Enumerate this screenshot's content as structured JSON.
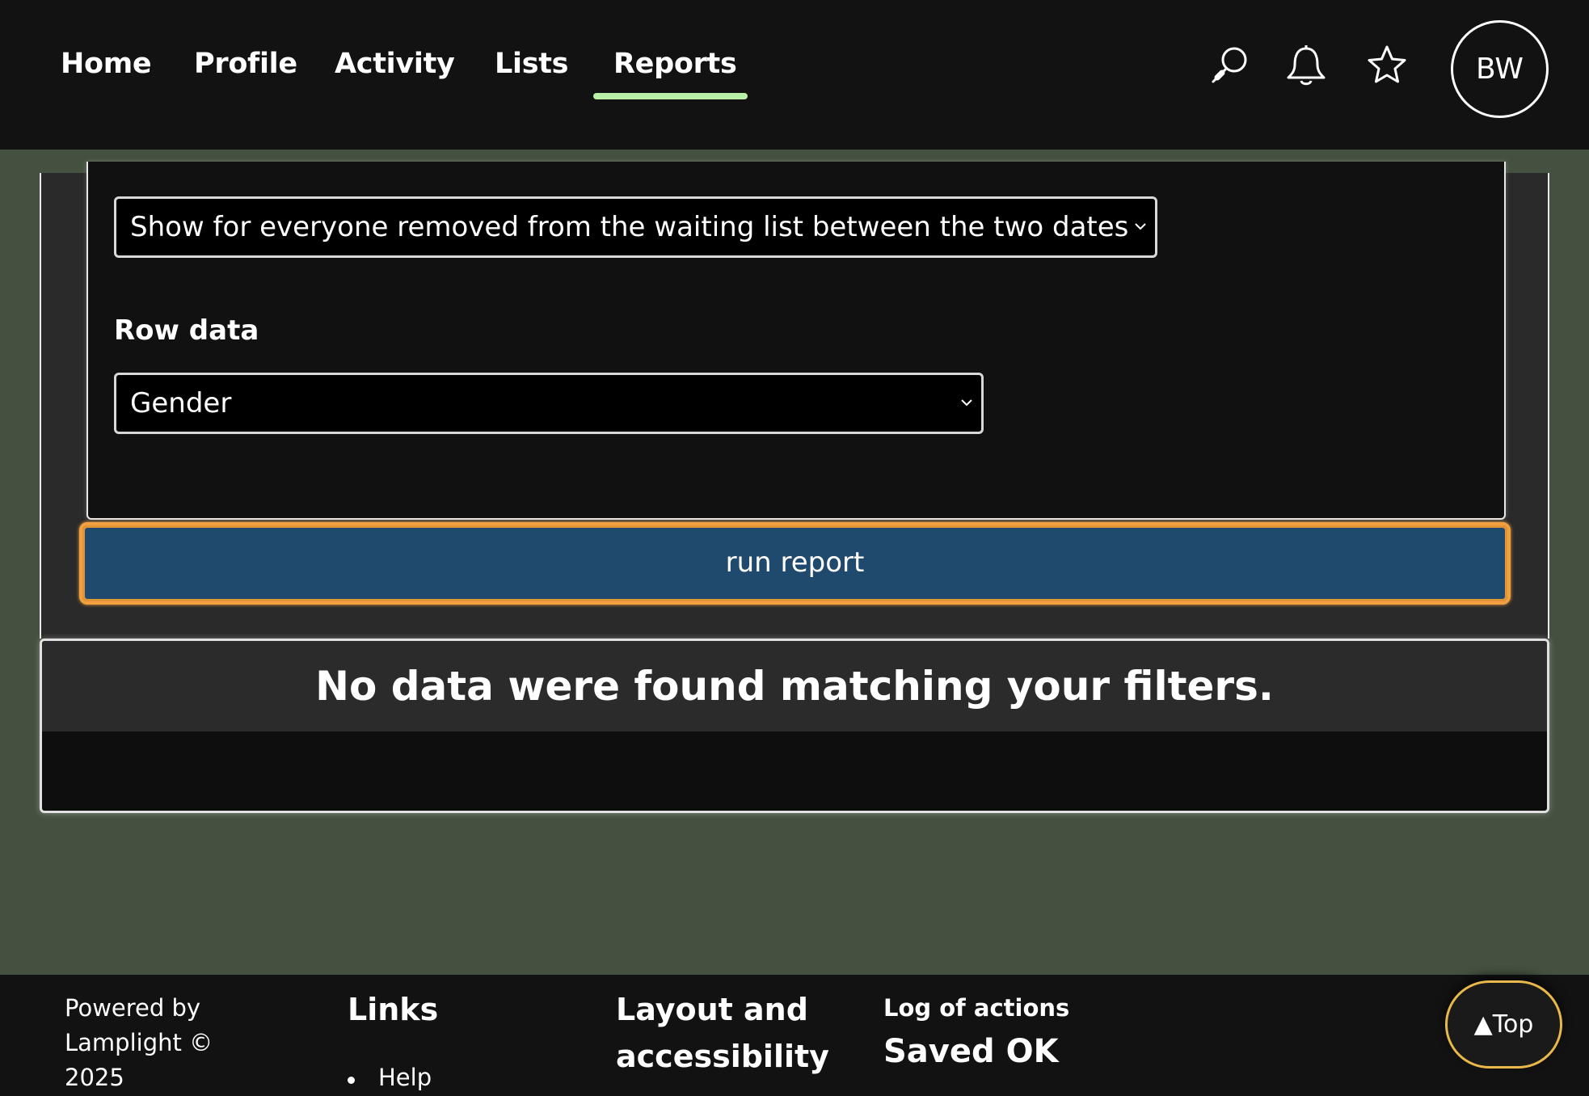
{
  "nav": {
    "items": [
      {
        "label": "Home"
      },
      {
        "label": "Profile"
      },
      {
        "label": "Activity"
      },
      {
        "label": "Lists"
      },
      {
        "label": "Reports",
        "active": true
      }
    ]
  },
  "header_icons": [
    "search-icon",
    "bell-icon",
    "star-icon"
  ],
  "user": {
    "initials": "BW"
  },
  "filters": {
    "scope_select_value": "Show for everyone removed from the waiting list between the two dates",
    "row_data_label": "Row data",
    "row_data_value": "Gender"
  },
  "run_button_label": "run report",
  "results": {
    "message": "No data were found matching your filters."
  },
  "footer": {
    "powered_by": "Powered by Lamplight © 2025",
    "links_heading": "Links",
    "links": [
      "Help"
    ],
    "layout_heading": "Layout and accessibility",
    "log_label": "Log of actions",
    "log_value": "Saved OK"
  },
  "top_button_label": "▲Top",
  "colors": {
    "background": "#445040",
    "header": "#121212",
    "nav_active_underline": "#b9f0a8",
    "run_button": "#1f4a6e",
    "focus_ring": "#f0a040"
  }
}
